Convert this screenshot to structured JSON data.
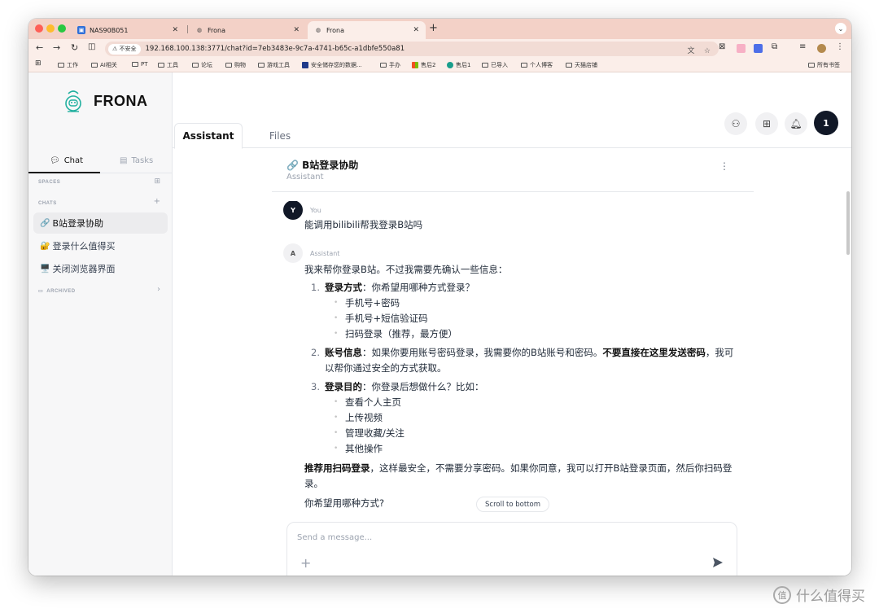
{
  "browser": {
    "tabs": [
      {
        "title": "NAS90B051",
        "active": false
      },
      {
        "title": "Frona",
        "active": false
      },
      {
        "title": "Frona",
        "active": true
      }
    ],
    "new_tab_label": "+",
    "insecure_label": "不安全",
    "url": "192.168.100.138:3771/chat?id=7eb3483e-9c7a-4741-b65c-a1dbfe550a81",
    "bookmarks": [
      "工作",
      "AI相关",
      "PT",
      "工具",
      "论坛",
      "购物",
      "游戏工具",
      "安全储存您的数据...",
      "手办",
      "售后2",
      "售后1",
      "已导入",
      "个人博客",
      "天猫店铺"
    ],
    "bookmarks_right": "所有书签"
  },
  "sidebar": {
    "brand": "FRONA",
    "tabs": [
      {
        "label": "Chat",
        "active": true
      },
      {
        "label": "Tasks",
        "active": false
      }
    ],
    "spaces_label": "SPACES",
    "chats_label": "CHATS",
    "chats": [
      {
        "icon": "🔗",
        "label": "B站登录协助",
        "active": true
      },
      {
        "icon": "🔐",
        "label": "登录什么值得买",
        "active": false
      },
      {
        "icon": "🖥️",
        "label": "关闭浏览器界面",
        "active": false
      }
    ],
    "archived_label": "ARCHIVED"
  },
  "main": {
    "tabs": [
      {
        "label": "Assistant",
        "active": true
      },
      {
        "label": "Files",
        "active": false
      }
    ],
    "user_avatar": "1",
    "chat_title": "🔗 B站登录协助",
    "chat_subtitle": "Assistant",
    "user_message": {
      "avatar": "Y",
      "name": "You",
      "text": "能调用bilibili帮我登录B站吗"
    },
    "assistant_message": {
      "avatar": "A",
      "name": "Assistant",
      "intro": "我来帮你登录B站。不过我需要先确认一些信息：",
      "items": [
        {
          "num": "1.",
          "bold": "登录方式",
          "text": "：你希望用哪种方式登录？",
          "bold2": "",
          "text2": "",
          "subs": [
            "手机号+密码",
            "手机号+短信验证码",
            "扫码登录（推荐，最方便）"
          ]
        },
        {
          "num": "2.",
          "bold": "账号信息",
          "text": "：如果你要用账号密码登录，我需要你的B站账号和密码。",
          "bold2": "不要直接在这里发送密码",
          "text2": "，我可以帮你通过安全的方式获取。",
          "subs": []
        },
        {
          "num": "3.",
          "bold": "登录目的",
          "text": "：你登录后想做什么？比如：",
          "bold2": "",
          "text2": "",
          "subs": [
            "查看个人主页",
            "上传视频",
            "管理收藏/关注",
            "其他操作"
          ]
        }
      ],
      "recommend_bold": "推荐用扫码登录",
      "recommend_text": "，这样最安全，不需要分享密码。如果你同意，我可以打开B站登录页面，然后你扫码登录。",
      "question": "你希望用哪种方式?"
    },
    "scroll_to_bottom": "Scroll to bottom",
    "composer_placeholder": "Send a message...",
    "composer_plus": "+"
  },
  "watermark": "什么值得买",
  "colors": {
    "tabstrip": "#f3d1c7",
    "toolbar": "#fbeee9",
    "dark": "#111827",
    "sidebar_bg": "#f7f7f8"
  }
}
